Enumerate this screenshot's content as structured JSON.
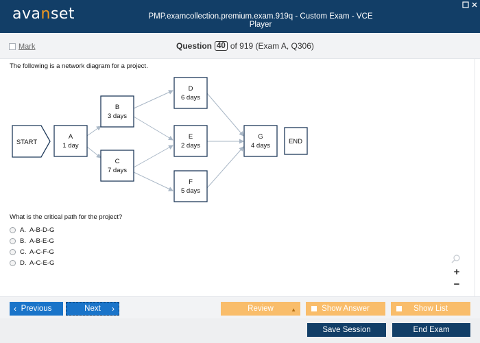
{
  "app": {
    "logo_prefix": "ava",
    "logo_accent": "n",
    "logo_suffix": "set",
    "window_title": "PMP.examcollection.premium.exam.919q - Custom Exam - VCE Player"
  },
  "header": {
    "mark_label": "Mark",
    "question_label": "Question",
    "question_number": "40",
    "question_total": "of 919 (Exam A, Q306)"
  },
  "question": {
    "text": "The following is a network diagram for a project.",
    "prompt": "What is the critical path for the project?",
    "options": [
      {
        "letter": "A.",
        "text": "A-B-D-G"
      },
      {
        "letter": "B.",
        "text": "A-B-E-G"
      },
      {
        "letter": "C.",
        "text": "A-C-F-G"
      },
      {
        "letter": "D.",
        "text": "A-C-E-G"
      }
    ]
  },
  "diagram": {
    "start": "START",
    "end": "END",
    "nodes": [
      {
        "id": "A",
        "duration": "1 day"
      },
      {
        "id": "B",
        "duration": "3 days"
      },
      {
        "id": "C",
        "duration": "7 days"
      },
      {
        "id": "D",
        "duration": "6 days"
      },
      {
        "id": "E",
        "duration": "2 days"
      },
      {
        "id": "F",
        "duration": "5 days"
      },
      {
        "id": "G",
        "duration": "4 days"
      }
    ]
  },
  "nav": {
    "previous": "Previous",
    "next": "Next",
    "review": "Review",
    "show_answer": "Show Answer",
    "show_list": "Show List",
    "save_session": "Save Session",
    "end_exam": "End Exam"
  },
  "colors": {
    "titlebar": "#123e67",
    "logo_accent": "#f39a1e",
    "primary_button": "#1a74c9",
    "secondary_button": "#f9bd6b",
    "node_border": "#1f3a5a",
    "arrow": "#a9b7c6"
  }
}
